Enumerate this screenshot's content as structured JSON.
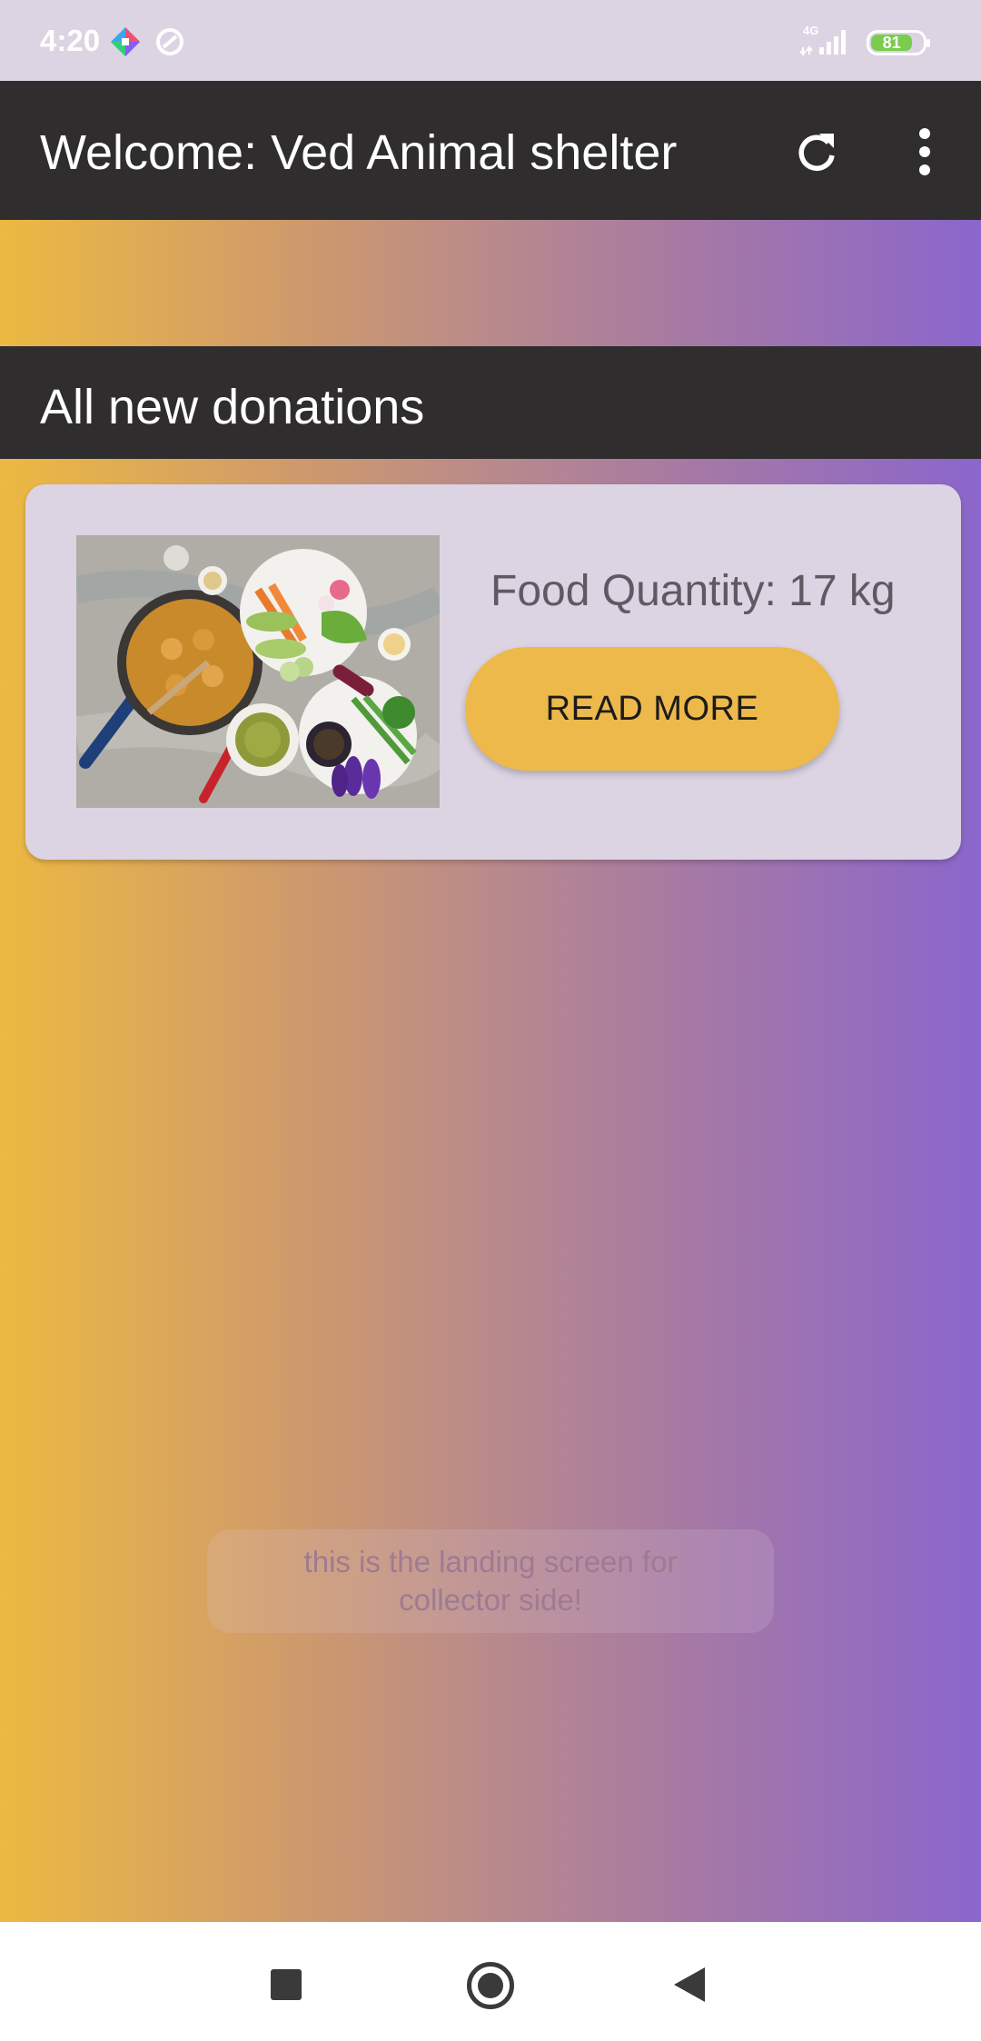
{
  "status_bar": {
    "time": "4:20",
    "network": "4G",
    "battery_level": "81",
    "icons": [
      "app-notification-icon",
      "sync-icon",
      "signal-icon",
      "battery-icon"
    ]
  },
  "app_bar": {
    "title": "Welcome: Ved Animal shelter",
    "actions": [
      "refresh-icon",
      "more-vert-icon"
    ]
  },
  "section": {
    "title": "All new donations"
  },
  "donations": [
    {
      "quantity_label": "Food Quantity: 17 kg",
      "button_label": "READ MORE"
    }
  ],
  "toast": {
    "message": "this is the landing screen for collector side!"
  },
  "nav_bar": {
    "buttons": [
      "recent-apps-icon",
      "home-icon",
      "back-icon"
    ]
  },
  "colors": {
    "app_bar": "#302d2e",
    "gradient_start": "#ecb942",
    "gradient_end": "#8b66cc",
    "card_bg": "#dcd4e3",
    "button": "#ecb94a",
    "status_bar": "#dcd4e3"
  }
}
